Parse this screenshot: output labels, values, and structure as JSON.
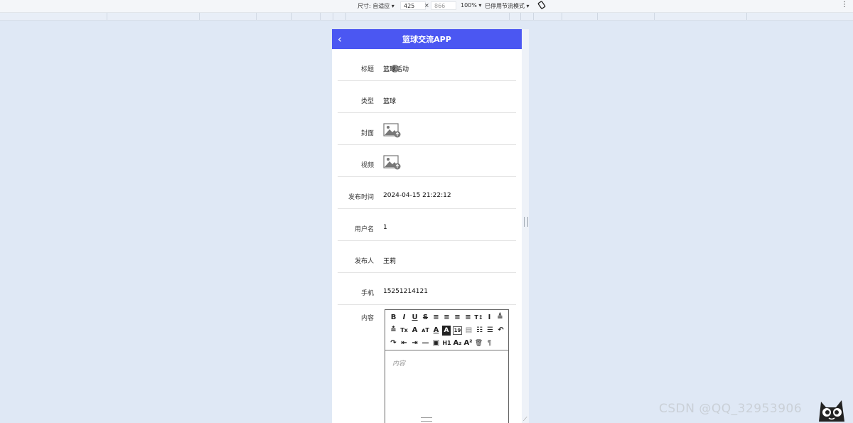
{
  "devtools": {
    "size_label": "尺寸: 自适应 ▾",
    "width": "425",
    "times": "×",
    "height": "866",
    "zoom": "100% ▾",
    "throttle": "已停用节流模式 ▾",
    "more": "⋮",
    "rotate_icon": "rotate-icon"
  },
  "app": {
    "title": "篮球交流APP",
    "back": "‹",
    "accent": "#4b57f2"
  },
  "fields": [
    {
      "label": "标题",
      "value": "篮球活动"
    },
    {
      "label": "类型",
      "value": "篮球"
    },
    {
      "label": "封面",
      "icon": "image-upload-icon"
    },
    {
      "label": "视频",
      "icon": "image-upload-icon"
    },
    {
      "label": "发布时间",
      "value": "2024-04-15 21:22:12"
    },
    {
      "label": "用户名",
      "value": "1"
    },
    {
      "label": "发布人",
      "value": "王莉"
    },
    {
      "label": "手机",
      "value": "15251214121"
    }
  ],
  "content": {
    "label": "内容",
    "placeholder": "内容",
    "toolbar": [
      [
        "B",
        "I",
        "U",
        "S",
        "≡",
        "≡",
        "≡",
        "≡",
        "T↕",
        "I",
        "≜"
      ],
      [
        "≛",
        "Tx",
        "A",
        "ᴀT",
        "A",
        "A",
        "19",
        "▤",
        "☷",
        "☰",
        "↶"
      ],
      [
        "↷",
        "⇤",
        "⇥",
        "—",
        "▣",
        "H1",
        "A₂",
        "A²",
        "🗑",
        "¶"
      ]
    ]
  },
  "watermark": "CSDN @QQ_32953906"
}
